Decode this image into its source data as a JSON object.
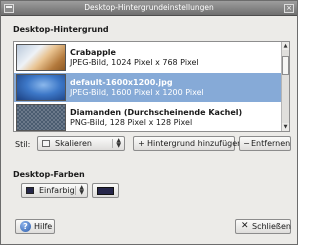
{
  "window": {
    "title": "Desktop-Hintergrundeinstellungen",
    "close_glyph": "×"
  },
  "background_section": {
    "title": "Desktop-Hintergrund",
    "wallpapers": [
      {
        "name": "Crabapple",
        "description": "JPEG-Bild, 1024 Pixel x 768 Pixel",
        "selected": false
      },
      {
        "name": "default-1600x1200.jpg",
        "description": "JPEG-Bild, 1600 Pixel x 1200 Pixel",
        "selected": true
      },
      {
        "name": "Diamanden (Durchscheinende Kachel)",
        "description": "PNG-Bild, 128 Pixel x 128 Pixel",
        "selected": false
      }
    ],
    "style_label": "Stil:",
    "style_value": "Skalieren",
    "add_button": "Hintergrund hinzufügen",
    "remove_button": "Entfernen"
  },
  "colors_section": {
    "title": "Desktop-Farben",
    "mode_value": "Einfarbig",
    "color": "#26264a"
  },
  "footer": {
    "help_button": "Hilfe",
    "close_button": "Schließen"
  },
  "icons": {
    "add": "+",
    "remove": "−",
    "help": "?",
    "close": "✕"
  },
  "colors": {
    "selection": "#86aad7",
    "titlebar": "#7f7f7f"
  }
}
